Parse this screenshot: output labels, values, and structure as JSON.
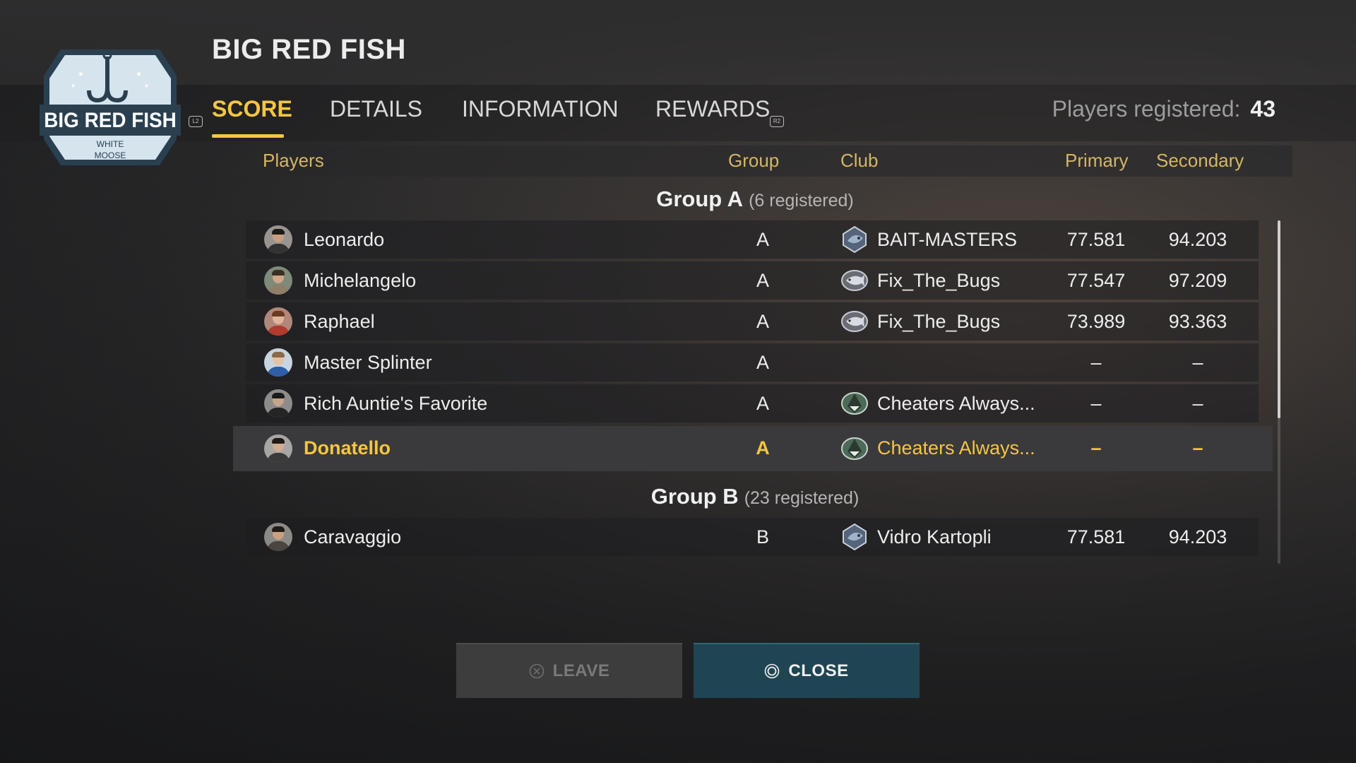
{
  "event": {
    "title": "BIG RED FISH",
    "logo_text": "BIG RED FISH",
    "logo_subtext_1": "WHITE",
    "logo_subtext_2": "MOOSE"
  },
  "nav": {
    "hint_left": "L2",
    "hint_right": "R2",
    "tabs": [
      {
        "label": "SCORE",
        "active": true
      },
      {
        "label": "DETAILS",
        "active": false
      },
      {
        "label": "INFORMATION",
        "active": false
      },
      {
        "label": "REWARDS",
        "active": false
      }
    ],
    "players_registered_label": "Players registered:",
    "players_registered_count": "43"
  },
  "table": {
    "columns": {
      "players": "Players",
      "group": "Group",
      "club": "Club",
      "primary": "Primary",
      "secondary": "Secondary"
    },
    "groups": [
      {
        "title": "Group A",
        "subtitle": "(6 registered)",
        "rows": [
          {
            "name": "Leonardo",
            "group": "A",
            "club": "BAIT-MASTERS",
            "club_icon": "bait-masters-emblem",
            "primary": "77.581",
            "secondary": "94.203"
          },
          {
            "name": "Michelangelo",
            "group": "A",
            "club": "Fix_The_Bugs",
            "club_icon": "fish-emblem",
            "primary": "77.547",
            "secondary": "97.209"
          },
          {
            "name": "Raphael",
            "group": "A",
            "club": "Fix_The_Bugs",
            "club_icon": "fish-emblem",
            "primary": "73.989",
            "secondary": "93.363"
          },
          {
            "name": "Master Splinter",
            "group": "A",
            "club": "",
            "club_icon": "",
            "primary": "–",
            "secondary": "–"
          },
          {
            "name": "Rich Auntie's Favorite",
            "group": "A",
            "club": "Cheaters Always...",
            "club_icon": "shark-emblem",
            "primary": "–",
            "secondary": "–"
          },
          {
            "name": "Donatello",
            "group": "A",
            "club": "Cheaters Always...",
            "club_icon": "shark-emblem",
            "primary": "–",
            "secondary": "–",
            "selected": true
          }
        ]
      },
      {
        "title": "Group B",
        "subtitle": "(23 registered)",
        "rows": [
          {
            "name": "Caravaggio",
            "group": "B",
            "club": "Vidro Kartopli",
            "club_icon": "bait-masters-emblem",
            "primary": "77.581",
            "secondary": "94.203"
          }
        ]
      }
    ]
  },
  "buttons": {
    "leave": {
      "label": "LEAVE",
      "icon": "cross-icon",
      "enabled": false
    },
    "close": {
      "label": "CLOSE",
      "icon": "circle-icon",
      "enabled": true
    }
  },
  "colors": {
    "accent": "#f5c542",
    "close_button": "#1f4552",
    "header_text": "#d4b666"
  }
}
